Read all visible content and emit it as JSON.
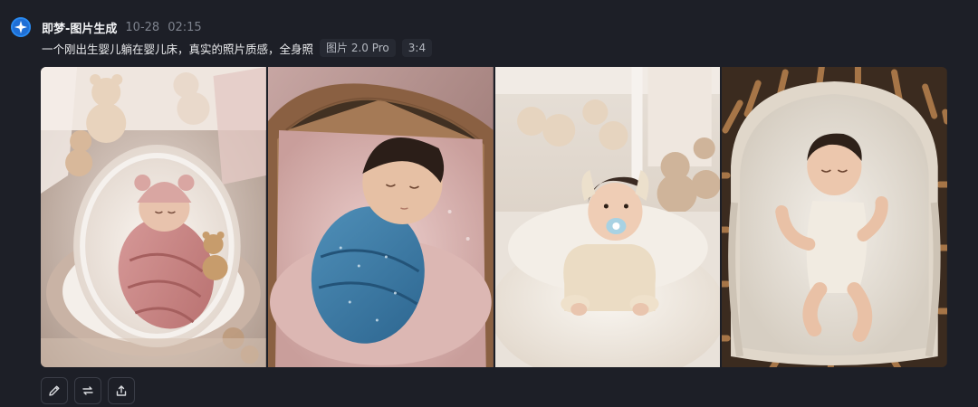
{
  "post": {
    "app_name": "即梦-图片生成",
    "date": "10-28",
    "time": "02:15",
    "prompt": "一个刚出生婴儿躺在婴儿床，真实的照片质感，全身照",
    "model_tag": "图片 2.0 Pro",
    "ratio_tag": "3:4"
  },
  "images": [
    {
      "subject": "newborn in pink knit hat swaddled in pink wrap with teddy bears"
    },
    {
      "subject": "sleeping newborn swaddled in blue dotted wrap on pink blanket"
    },
    {
      "subject": "baby in cream outfit with pacifier sitting on white cushion"
    },
    {
      "subject": "sleeping baby in white romper in wooden bassinet"
    }
  ],
  "toolbar": {
    "icons": [
      "edit-icon",
      "regenerate-icon",
      "share-icon"
    ]
  },
  "colors": {
    "background": "#1d1f27",
    "accent": "#1f6fd6",
    "tag_background": "#262932"
  }
}
